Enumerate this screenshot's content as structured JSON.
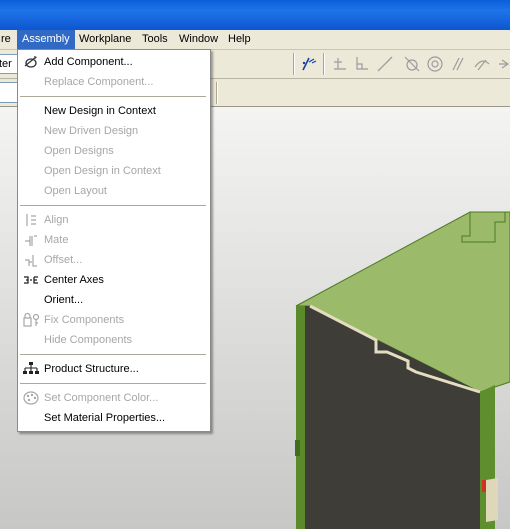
{
  "menubar": {
    "items": [
      {
        "label": "re",
        "active": false
      },
      {
        "label": "Assembly",
        "active": true
      },
      {
        "label": "Workplane",
        "active": false
      },
      {
        "label": "Tools",
        "active": false
      },
      {
        "label": "Window",
        "active": false
      },
      {
        "label": "Help",
        "active": false
      }
    ]
  },
  "toolbar": {
    "style_combo_value": "ter A"
  },
  "assembly_menu": {
    "items": [
      {
        "label": "Add Component...",
        "enabled": true,
        "icon": "add-component-icon"
      },
      {
        "label": "Replace Component...",
        "enabled": false
      },
      {
        "label": "New Design in Context",
        "enabled": true
      },
      {
        "label": "New Driven Design",
        "enabled": false
      },
      {
        "label": "Open Designs",
        "enabled": false
      },
      {
        "label": "Open Design in Context",
        "enabled": false
      },
      {
        "label": "Open Layout",
        "enabled": false
      },
      {
        "label": "Align",
        "enabled": false,
        "icon": "align-icon"
      },
      {
        "label": "Mate",
        "enabled": false,
        "icon": "mate-icon"
      },
      {
        "label": "Offset...",
        "enabled": false,
        "icon": "offset-icon"
      },
      {
        "label": "Center Axes",
        "enabled": true,
        "icon": "center-axes-icon"
      },
      {
        "label": "Orient...",
        "enabled": true
      },
      {
        "label": "Fix Components",
        "enabled": false,
        "icon": "fix-components-icon"
      },
      {
        "label": "Hide Components",
        "enabled": false
      },
      {
        "label": "Product Structure...",
        "enabled": true,
        "icon": "product-structure-icon"
      },
      {
        "label": "Set Component Color...",
        "enabled": false,
        "icon": "color-palette-icon"
      },
      {
        "label": "Set Material Properties...",
        "enabled": true
      }
    ]
  },
  "colors": {
    "titlebar": "#1f74ea",
    "menu_highlight": "#316ac5",
    "model_top": "#9bba6a",
    "model_front": "#3e3d38",
    "model_edge": "#5a8a2a",
    "model_cut": "#ded8b8"
  }
}
